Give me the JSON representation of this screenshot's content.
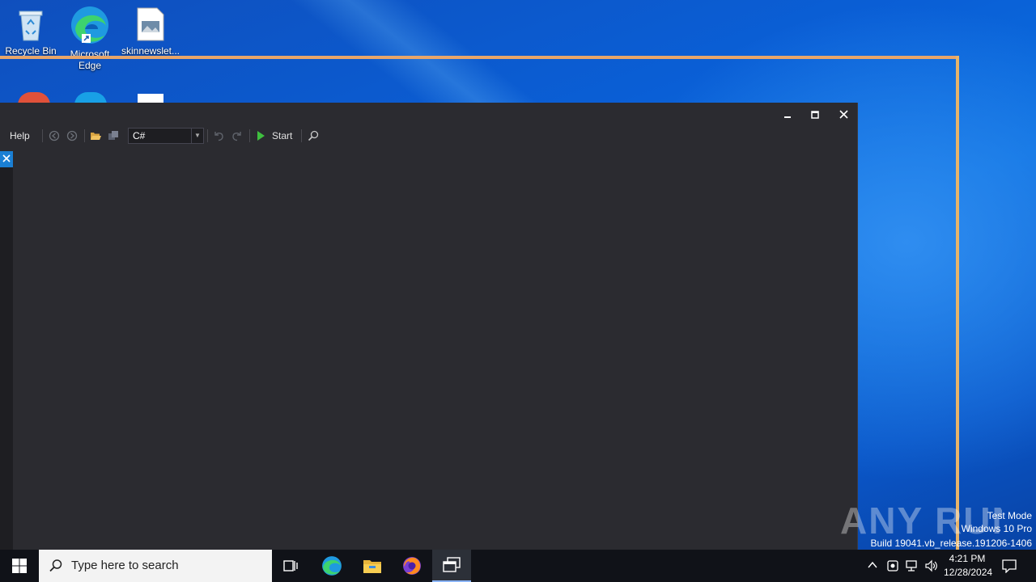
{
  "desktop": {
    "icons": [
      {
        "label": "Recycle Bin",
        "icon": "recycle-bin-icon"
      },
      {
        "label": "Microsoft Edge",
        "icon": "edge-icon"
      },
      {
        "label": "skinnewslet...",
        "icon": "image-file-icon"
      }
    ]
  },
  "window": {
    "menu_help": "Help",
    "language_select": "C#",
    "start_label": "Start",
    "controls": {
      "minimize": "minimize-icon",
      "maximize": "maximize-icon",
      "close": "close-icon"
    }
  },
  "watermark": {
    "brand": "ANY RUN",
    "test_mode": "Test Mode",
    "edition": "Windows 10 Pro",
    "build": "Build 19041.vb_release.191206-1406"
  },
  "taskbar": {
    "search_placeholder": "Type here to search",
    "time": "4:21 PM",
    "date": "12/28/2024"
  },
  "colors": {
    "accent": "#1a7fd4",
    "window_bg": "#2b2b30",
    "start_green": "#3fbf3f"
  }
}
